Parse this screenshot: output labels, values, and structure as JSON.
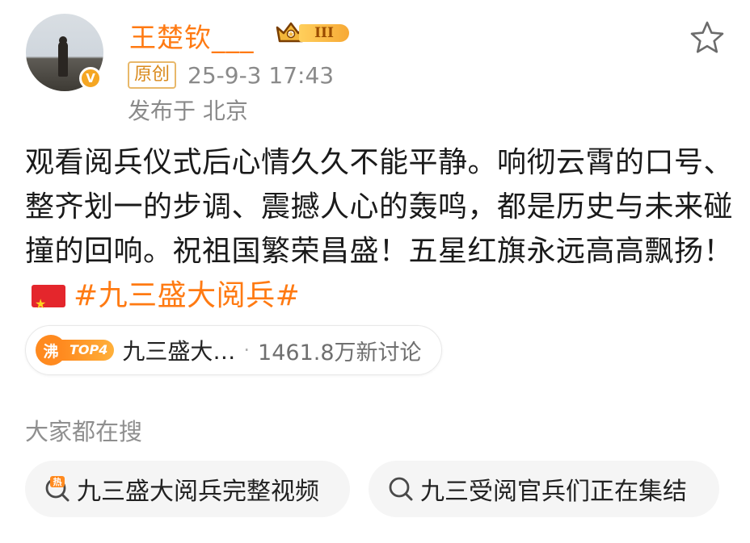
{
  "post": {
    "author": {
      "name": "王楚钦___",
      "verified_badge": "V",
      "vip_level": "III"
    },
    "original_tag": "原创",
    "timestamp": "25-9-3 17:43",
    "location": "发布于 北京",
    "text_main": "观看阅兵仪式后心情久久不能平静。响彻云霄的口号、整齐划一的步调、震撼人心的轰鸣，都是历史与未来碰撞的回响。祝祖国繁荣昌盛！五星红旗永远高高飘扬！",
    "hashtag": "#九三盛大阅兵#",
    "flag_icon": "china-flag-emoji",
    "star_icon": "star-outline-icon"
  },
  "topic_card": {
    "hot_label": "沸",
    "rank_label": "TOP4",
    "title": "九三盛大…",
    "separator": "·",
    "discussion_count": "1461.8万新讨论"
  },
  "search_section": {
    "label": "大家都在搜",
    "suggestions": [
      {
        "text": "九三盛大阅兵完整视频",
        "icon": "hot-search-icon"
      },
      {
        "text": "九三受阅官兵们正在集结",
        "icon": "search-icon"
      }
    ]
  },
  "colors": {
    "accent": "#ff7a12",
    "muted": "#8a8a8a",
    "badge_gold": "#f5a623"
  }
}
